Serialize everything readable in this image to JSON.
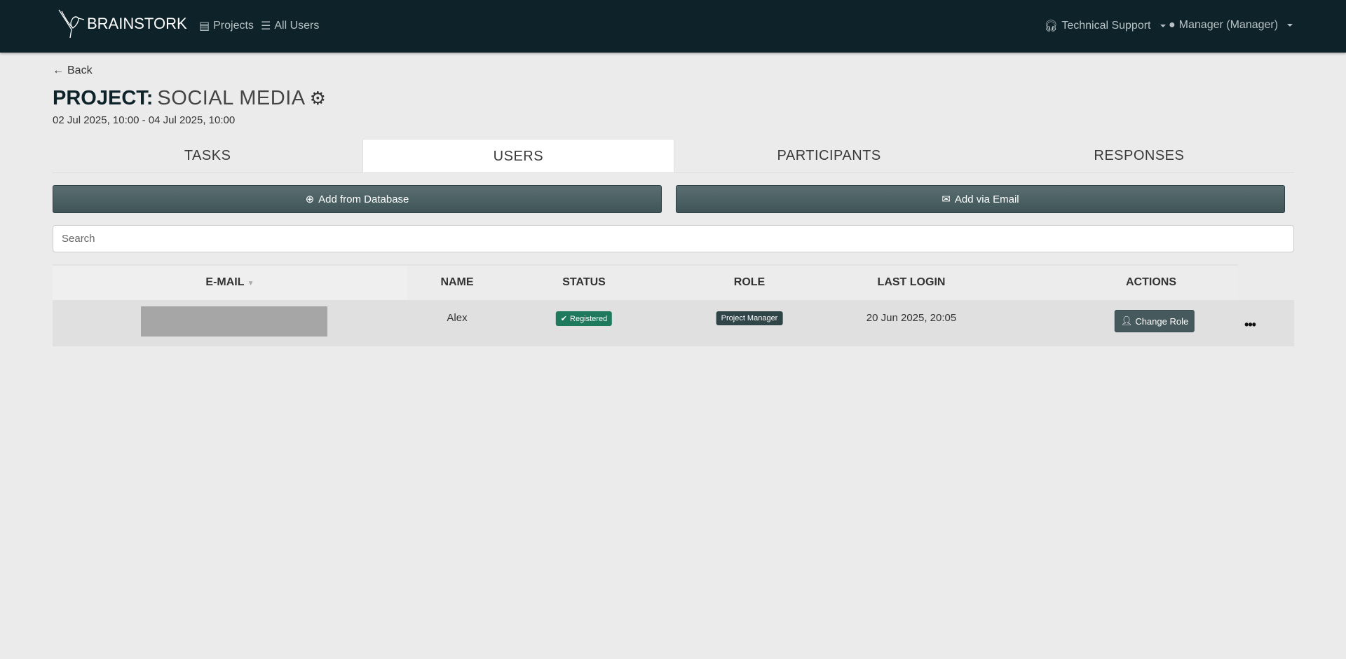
{
  "nav": {
    "brand": "BRAINSTORK",
    "projects": "Projects",
    "all_users": "All Users",
    "support": "Technical Support",
    "user": "Manager (Manager)"
  },
  "page": {
    "back": "Back",
    "title_prefix": "PROJECT:",
    "title_name": "SOCIAL MEDIA",
    "dates": "02 Jul 2025, 10:00 - 04 Jul 2025, 10:00"
  },
  "tabs": [
    {
      "label": "TASKS"
    },
    {
      "label": "USERS",
      "active": true
    },
    {
      "label": "PARTICIPANTS"
    },
    {
      "label": "RESPONSES"
    }
  ],
  "actions": {
    "add_db": "Add from Database",
    "add_email": "Add via Email",
    "search_placeholder": "Search"
  },
  "table": {
    "headers": [
      "E-MAIL",
      "NAME",
      "STATUS",
      "ROLE",
      "LAST LOGIN",
      "ACTIONS"
    ],
    "rows": [
      {
        "name": "Alex",
        "status": "Registered",
        "role": "Project Manager",
        "last_login": "20 Jun 2025, 20:05",
        "action": "Change Role",
        "more": "•••"
      }
    ]
  },
  "colors": {
    "navbar": "#0d2329",
    "registered": "#1f7a5d",
    "role": "#2f4548"
  }
}
